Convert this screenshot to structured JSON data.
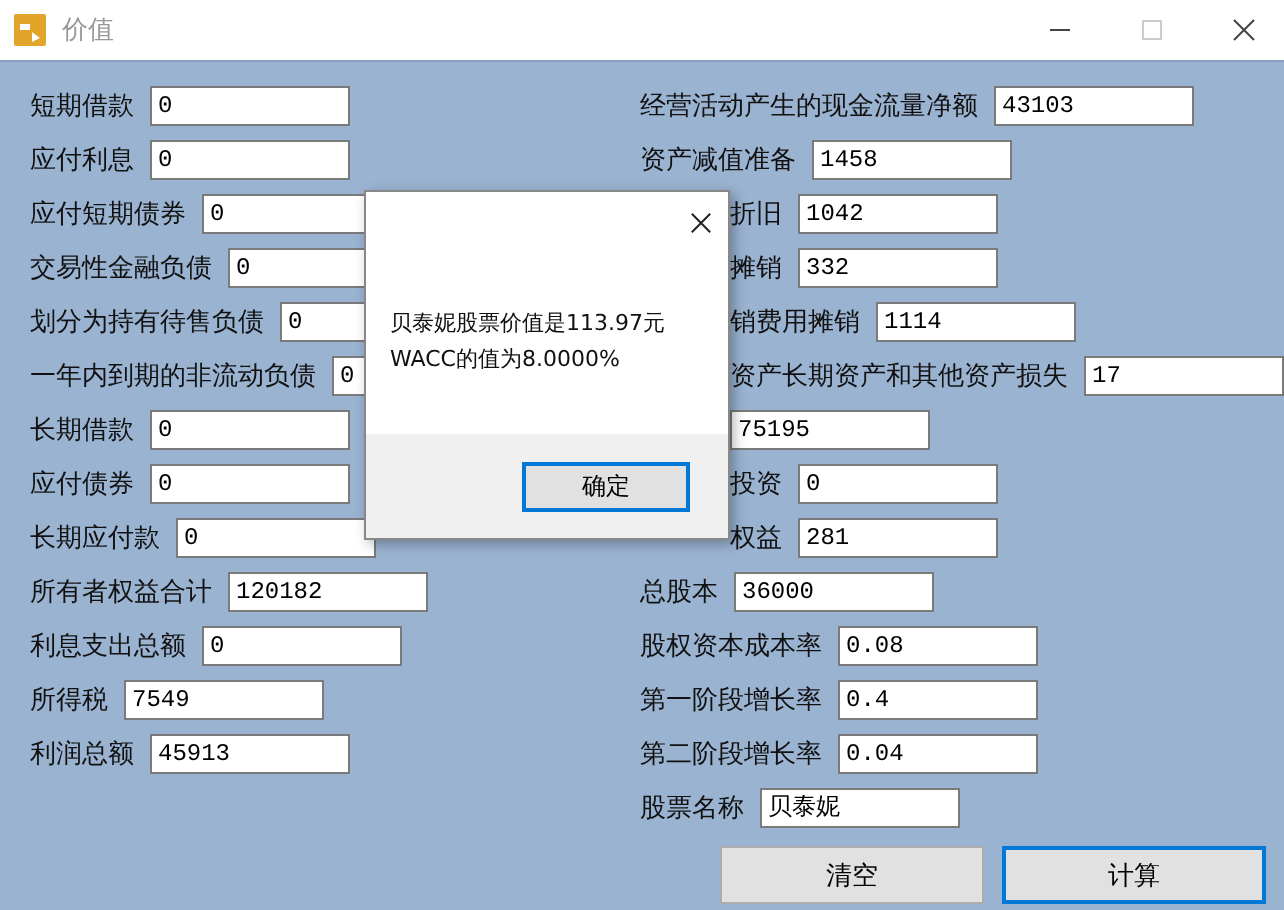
{
  "window": {
    "title": "价值"
  },
  "left_fields": [
    {
      "label": "短期借款",
      "value": "0"
    },
    {
      "label": "应付利息",
      "value": "0"
    },
    {
      "label": "应付短期债券",
      "value": "0"
    },
    {
      "label": "交易性金融负债",
      "value": "0"
    },
    {
      "label": "划分为持有待售负债",
      "value": "0"
    },
    {
      "label": "一年内到期的非流动负债",
      "value": "0"
    },
    {
      "label": "长期借款",
      "value": "0"
    },
    {
      "label": "应付债券",
      "value": "0"
    },
    {
      "label": "长期应付款",
      "value": "0"
    },
    {
      "label": "所有者权益合计",
      "value": "120182"
    },
    {
      "label": "利息支出总额",
      "value": "0"
    },
    {
      "label": "所得税",
      "value": "7549"
    },
    {
      "label": "利润总额",
      "value": "45913"
    }
  ],
  "right_fields": [
    {
      "label": "经营活动产生的现金流量净额",
      "value": "43103"
    },
    {
      "label": "资产减值准备",
      "value": "1458"
    },
    {
      "label": "折旧",
      "value": "1042",
      "partly_hidden": true
    },
    {
      "label": "摊销",
      "value": "332",
      "partly_hidden": true
    },
    {
      "label": "销费用摊销",
      "value": "1114",
      "partly_hidden": true
    },
    {
      "label": "资产长期资产和其他资产损失",
      "value": "17",
      "partly_hidden": true
    },
    {
      "value": "75195",
      "partly_hidden": true
    },
    {
      "label": "投资",
      "value": "0",
      "partly_hidden": true
    },
    {
      "label": "权益",
      "value": "281",
      "partly_hidden": true
    },
    {
      "label": "总股本",
      "value": "36000"
    },
    {
      "label": "股权资本成本率",
      "value": "0.08"
    },
    {
      "label": "第一阶段增长率",
      "value": "0.4"
    },
    {
      "label": "第二阶段增长率",
      "value": "0.04"
    },
    {
      "label": "股票名称",
      "value": "贝泰妮"
    }
  ],
  "buttons": [
    {
      "label": "清空",
      "focused": false
    },
    {
      "label": "计算",
      "focused": true
    }
  ],
  "dialog": {
    "lines": [
      "贝泰妮股票价值是113.97元",
      "WACC的值为8.0000%"
    ],
    "button": "确定"
  }
}
